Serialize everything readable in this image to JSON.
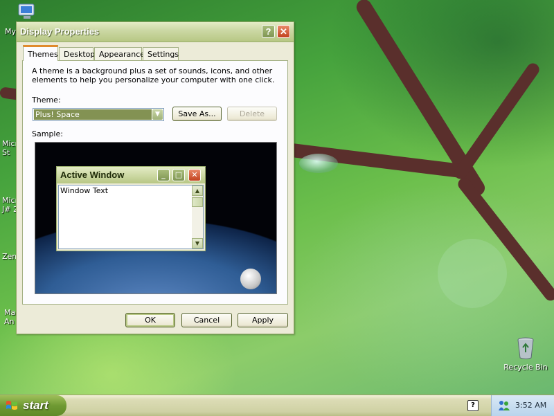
{
  "desktop": {
    "icons": [
      {
        "label": "My"
      },
      {
        "label": "Micr\nSt"
      },
      {
        "label": "Micr\nJ# 2"
      },
      {
        "label": "Zem"
      },
      {
        "label": "Mal\nAn"
      }
    ],
    "recycle_bin": {
      "label": "Recycle Bin",
      "icon": "recycle-bin-icon"
    }
  },
  "dialog": {
    "title": "Display Properties",
    "help_button": "?",
    "close_button": "✕",
    "tabs": [
      {
        "label": "Themes",
        "active": true
      },
      {
        "label": "Desktop",
        "active": false
      },
      {
        "label": "Appearance",
        "active": false
      },
      {
        "label": "Settings",
        "active": false
      }
    ],
    "description": "A theme is a background plus a set of sounds, icons, and other elements to help you personalize your computer with one click.",
    "theme_label": "Theme:",
    "theme_value": "Plus! Space",
    "save_as_label": "Save As...",
    "delete_label": "Delete",
    "sample_label": "Sample:",
    "sample": {
      "window_title": "Active Window",
      "window_text": "Window Text",
      "minimize": "_",
      "maximize": "□",
      "close": "✕"
    },
    "ok_label": "OK",
    "cancel_label": "Cancel",
    "apply_label": "Apply"
  },
  "taskbar": {
    "start_label": "start",
    "tray_help": "?",
    "clock": "3:52 AM"
  },
  "colors": {
    "title_bar": "#b7c784",
    "selected_theme": "#839253",
    "active_tab_accent": "#e08a2c",
    "start_button": "#6f9a33"
  }
}
